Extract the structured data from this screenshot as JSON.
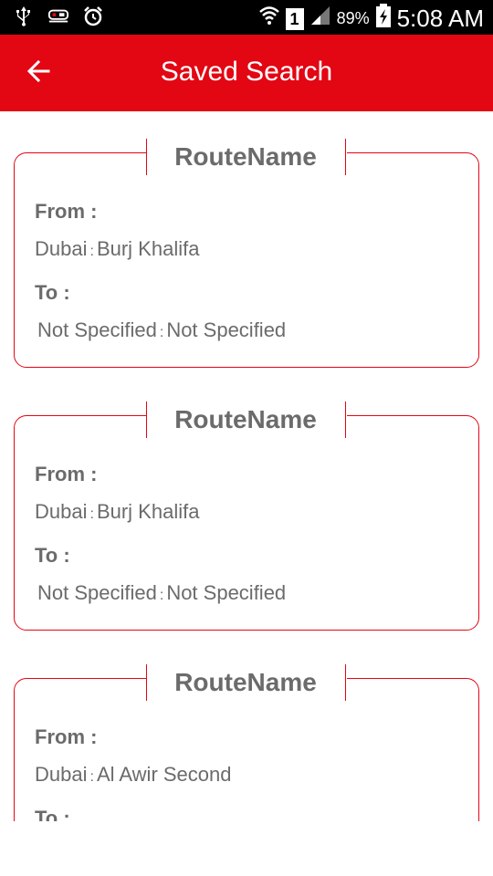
{
  "status_bar": {
    "left_icons": [
      "usb-icon",
      "app-icon",
      "alarm-icon"
    ],
    "battery_percent": "89%",
    "sim_label": "1",
    "time": "5:08 AM"
  },
  "header": {
    "title": "Saved Search",
    "back_icon": "arrow-left-icon"
  },
  "colors": {
    "accent": "#e30613",
    "text": "#6b6b6b"
  },
  "cards": [
    {
      "route_name": "RouteName",
      "from_label": "From :",
      "from_city": "Dubai",
      "from_place": "Burj Khalifa",
      "to_label": "To :",
      "to_city": "Not Specified",
      "to_place": "Not Specified",
      "separator": ":"
    },
    {
      "route_name": "RouteName",
      "from_label": "From :",
      "from_city": "Dubai",
      "from_place": "Burj Khalifa",
      "to_label": "To :",
      "to_city": "Not Specified",
      "to_place": "Not Specified",
      "separator": ":"
    },
    {
      "route_name": "RouteName",
      "from_label": "From :",
      "from_city": "Dubai",
      "from_place": "Al Awir Second",
      "to_label": "To :",
      "to_city": "",
      "to_place": "",
      "separator": ":"
    }
  ]
}
